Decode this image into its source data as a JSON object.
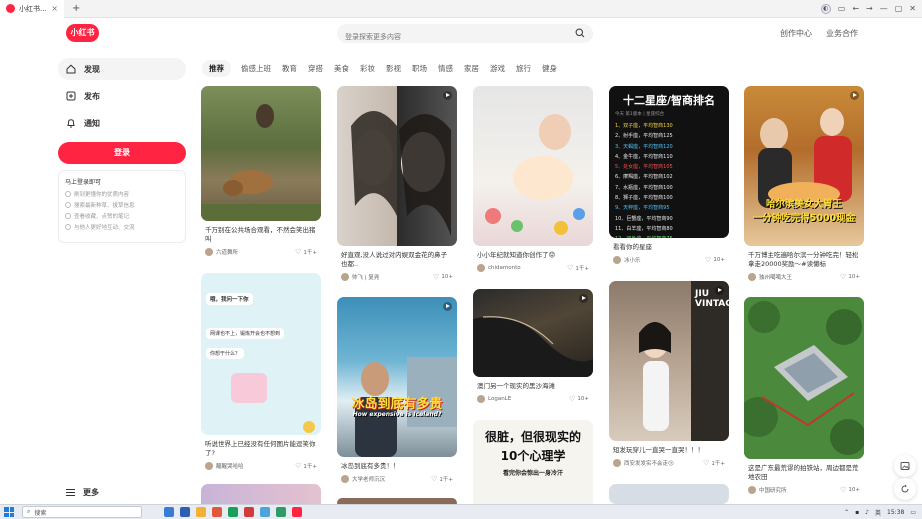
{
  "browser": {
    "tab_title": "小红书...",
    "tab_close": "×",
    "new_tab": "+"
  },
  "header": {
    "logo": "小红书",
    "search_placeholder": "登录探索更多内容",
    "links": [
      "创作中心",
      "业务合作"
    ]
  },
  "sidebar": {
    "items": [
      {
        "label": "发现",
        "icon": "home-icon"
      },
      {
        "label": "发布",
        "icon": "publish-icon"
      },
      {
        "label": "通知",
        "icon": "bell-icon"
      }
    ],
    "login_button": "登录",
    "login_card": {
      "title": "马上登录即可",
      "lines": [
        "刷到更懂你的优质内容",
        "搜索最新种草、拔草信息",
        "查看收藏、点赞的笔记",
        "与他人更好地互动、交流"
      ]
    },
    "more": "更多"
  },
  "categories": [
    "推荐",
    "偷感上班",
    "教育",
    "穿搭",
    "美食",
    "彩妆",
    "影视",
    "职场",
    "情感",
    "家居",
    "游戏",
    "旅行",
    "健身"
  ],
  "feed": [
    {
      "title": "千万别在公共场合观看，不然会笑出猪叫",
      "author": "六道舞所",
      "likes": "1千+"
    },
    {
      "title": "好直观,没人说过对内娱双金花的鼻子也都..",
      "author": "帅飞 | 复尧",
      "likes": "10+"
    },
    {
      "title": "小小年纪就知道你创作了😟",
      "author": "chidamonto",
      "likes": "1千+"
    },
    {
      "title": "看看你的星座",
      "author": "冰小乐",
      "likes": "10+"
    },
    {
      "title": "千万博主吃遍哈尔滨一分钟吃完！轻松拿走20000奖励～#读懒标",
      "author": "独州噶噶大王",
      "likes": "10+"
    },
    {
      "title": "听说世界上已经没有任何图片能逗笑你了?",
      "author": "醒醒哭哈哈",
      "likes": "1千+"
    },
    {
      "title": "冰岛到底有多贵！！",
      "author": "大学老师沉沉",
      "likes": "1千+"
    },
    {
      "title": "澳门另一个现实的黑沙海滩",
      "author": "LoganLE",
      "likes": "10+"
    },
    {
      "title": "短发玩穿儿一直哭一直哭！！！",
      "author": "西安发发实不会走😗",
      "likes": "1千+"
    },
    {
      "title": "这是广东最荒谬的拍铁站，周边都是荒地农田",
      "author": "中国研究所",
      "likes": "10+"
    }
  ],
  "overlays": {
    "ranking_title": "十二星座/智商排名",
    "ranking_sub": "今天 第1版本 | 星座综合",
    "ranking": [
      {
        "text": "1、双子座，平均智商130",
        "color": "#f3d34a"
      },
      {
        "text": "2、射手座，平均智商125",
        "color": "#e8e8e8"
      },
      {
        "text": "3、天蝎座，平均智商120",
        "color": "#4fc3f7"
      },
      {
        "text": "4、金牛座，平均智商110",
        "color": "#e8e8e8"
      },
      {
        "text": "5、处女座，平均智商105",
        "color": "#ff4d4d"
      },
      {
        "text": "6、摩羯座，平均智商102",
        "color": "#e8e8e8"
      },
      {
        "text": "7、水瓶座，平均智商100",
        "color": "#e8e8e8"
      },
      {
        "text": "8、狮子座，平均智商100",
        "color": "#e8e8e8"
      },
      {
        "text": "9、天秤座，平均智商95",
        "color": "#4fc3f7"
      },
      {
        "text": "10、巨蟹座，平均智商90",
        "color": "#e8e8e8"
      },
      {
        "text": "11、白羊座，平均智商80",
        "color": "#e8e8e8"
      },
      {
        "text": "12、双鱼座，平均智商75",
        "color": "#6fdc6f"
      }
    ],
    "food_line1": "哈尔滨美女大胃王",
    "food_line2": "一分钟吃完得5000现金",
    "iceland_cn": "冰岛到底有多贵",
    "iceland_en": "How expensive is Iceland?",
    "psych_line1": "很脏，但很现实的",
    "psych_line2": "10个心理学",
    "psych_line3": "看完你会惊出一身冷汗",
    "chat_lines": [
      "哦，我问一下你",
      "网课也不上，锻炼开会也不想到",
      "你想干什么？"
    ],
    "shop_sign": "JIU VINTAGE"
  },
  "taskbar": {
    "search": "搜索",
    "lang": "英",
    "time": "15:38"
  },
  "colors": {
    "brand": "#ff2442"
  }
}
